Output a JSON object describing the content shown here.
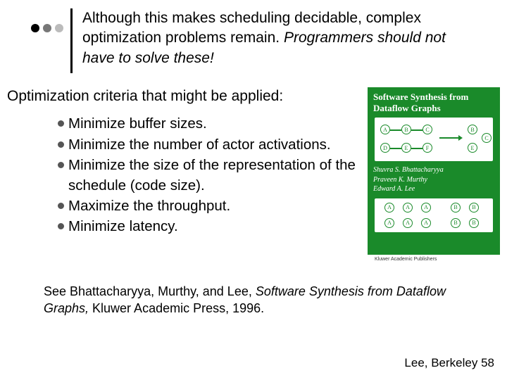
{
  "header": {
    "line1": "Although this makes scheduling decidable, complex optimization problems remain.",
    "line2": "Programmers should not have to solve these!"
  },
  "criteria_heading": "Optimization criteria that might be applied:",
  "bullets": [
    "Minimize buffer sizes.",
    "Minimize the number of actor activations.",
    "Minimize the size of the representation of the schedule (code size).",
    "Maximize the throughput.",
    "Minimize latency."
  ],
  "book": {
    "title": "Software Synthesis from Dataflow Graphs",
    "authors": [
      "Shuvra S. Bhattacharyya",
      "Praveen K. Murthy",
      "Edward A. Lee"
    ],
    "publisher_caption": "Kluwer Academic Publishers"
  },
  "citation": {
    "pre": "See Bhattacharyya, Murthy, and Lee, ",
    "title": "Software Synthesis from Dataflow Graphs,",
    "post": " Kluwer Academic Press, 1996."
  },
  "footer": "Lee, Berkeley 58"
}
